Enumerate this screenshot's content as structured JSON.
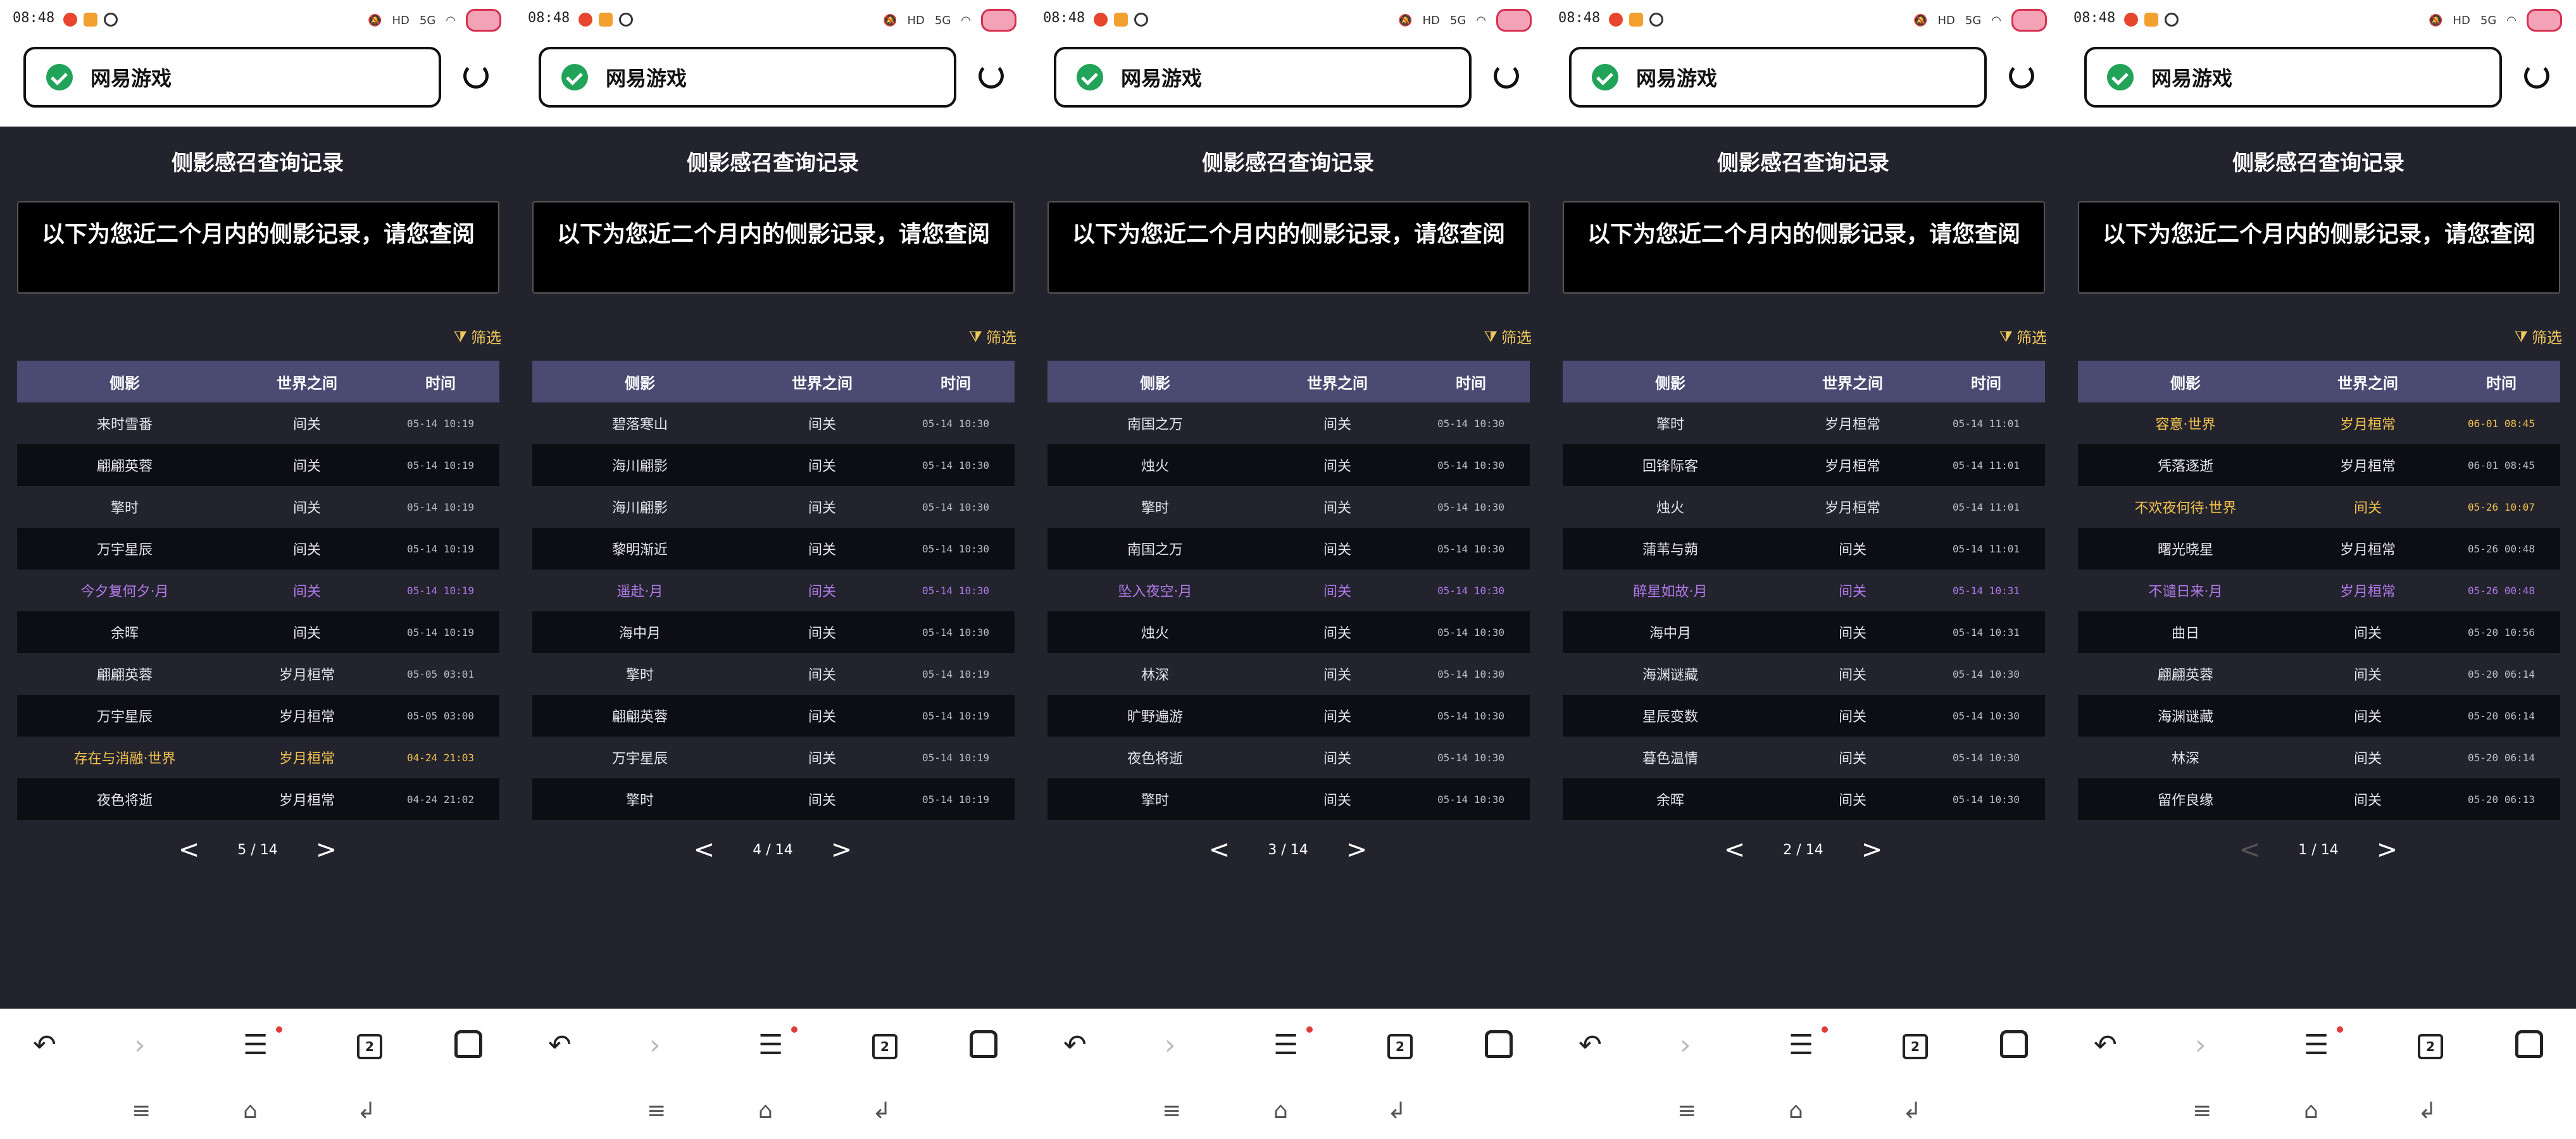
{
  "status": {
    "time": "08:48",
    "network": "5G",
    "hd": "HD"
  },
  "colors": {
    "page_bg": "#23232e",
    "header_row": "#4a4a72",
    "purple": "#b07ae8",
    "gold": "#f2c24e",
    "shield": "#22a35a"
  },
  "browser": {
    "address": "网易游戏",
    "tab_count": "2"
  },
  "page": {
    "title": "侧影感召查询记录",
    "notice": "以下为您近二个月内的侧影记录，请您查阅",
    "filter": "筛选"
  },
  "table_headers": {
    "col1": "侧影",
    "col2": "世界之间",
    "col3": "时间"
  },
  "pager": {
    "prev": "<",
    "next": ">"
  },
  "panels": [
    {
      "page": "5 / 14",
      "rows": [
        {
          "c1": "来时雪番",
          "c2": "间关",
          "c3": "05-14 10:19",
          "style": ""
        },
        {
          "c1": "翩翩英蓉",
          "c2": "间关",
          "c3": "05-14 10:19",
          "style": ""
        },
        {
          "c1": "擎时",
          "c2": "间关",
          "c3": "05-14 10:19",
          "style": ""
        },
        {
          "c1": "万宇星辰",
          "c2": "间关",
          "c3": "05-14 10:19",
          "style": ""
        },
        {
          "c1": "今夕复何夕·月",
          "c2": "间关",
          "c3": "05-14 10:19",
          "style": "purple"
        },
        {
          "c1": "余晖",
          "c2": "间关",
          "c3": "05-14 10:19",
          "style": ""
        },
        {
          "c1": "翩翩英蓉",
          "c2": "岁月桓常",
          "c3": "05-05 03:01",
          "style": ""
        },
        {
          "c1": "万宇星辰",
          "c2": "岁月桓常",
          "c3": "05-05 03:00",
          "style": ""
        },
        {
          "c1": "存在与消融·世界",
          "c2": "岁月桓常",
          "c3": "04-24 21:03",
          "style": "gold"
        },
        {
          "c1": "夜色将逝",
          "c2": "岁月桓常",
          "c3": "04-24 21:02",
          "style": ""
        }
      ]
    },
    {
      "page": "4 / 14",
      "rows": [
        {
          "c1": "碧落寒山",
          "c2": "间关",
          "c3": "05-14 10:30",
          "style": ""
        },
        {
          "c1": "海川翩影",
          "c2": "间关",
          "c3": "05-14 10:30",
          "style": ""
        },
        {
          "c1": "海川翩影",
          "c2": "间关",
          "c3": "05-14 10:30",
          "style": ""
        },
        {
          "c1": "黎明渐近",
          "c2": "间关",
          "c3": "05-14 10:30",
          "style": ""
        },
        {
          "c1": "遥赴·月",
          "c2": "间关",
          "c3": "05-14 10:30",
          "style": "purple"
        },
        {
          "c1": "海中月",
          "c2": "间关",
          "c3": "05-14 10:30",
          "style": ""
        },
        {
          "c1": "擎时",
          "c2": "间关",
          "c3": "05-14 10:19",
          "style": ""
        },
        {
          "c1": "翩翩英蓉",
          "c2": "间关",
          "c3": "05-14 10:19",
          "style": ""
        },
        {
          "c1": "万宇星辰",
          "c2": "间关",
          "c3": "05-14 10:19",
          "style": ""
        },
        {
          "c1": "擎时",
          "c2": "间关",
          "c3": "05-14 10:19",
          "style": ""
        }
      ]
    },
    {
      "page": "3 / 14",
      "rows": [
        {
          "c1": "南国之万",
          "c2": "间关",
          "c3": "05-14 10:30",
          "style": ""
        },
        {
          "c1": "烛火",
          "c2": "间关",
          "c3": "05-14 10:30",
          "style": ""
        },
        {
          "c1": "擎时",
          "c2": "间关",
          "c3": "05-14 10:30",
          "style": ""
        },
        {
          "c1": "南国之万",
          "c2": "间关",
          "c3": "05-14 10:30",
          "style": ""
        },
        {
          "c1": "坠入夜空·月",
          "c2": "间关",
          "c3": "05-14 10:30",
          "style": "purple"
        },
        {
          "c1": "烛火",
          "c2": "间关",
          "c3": "05-14 10:30",
          "style": ""
        },
        {
          "c1": "林深",
          "c2": "间关",
          "c3": "05-14 10:30",
          "style": ""
        },
        {
          "c1": "旷野遍游",
          "c2": "间关",
          "c3": "05-14 10:30",
          "style": ""
        },
        {
          "c1": "夜色将逝",
          "c2": "间关",
          "c3": "05-14 10:30",
          "style": ""
        },
        {
          "c1": "擎时",
          "c2": "间关",
          "c3": "05-14 10:30",
          "style": ""
        }
      ]
    },
    {
      "page": "2 / 14",
      "rows": [
        {
          "c1": "擎时",
          "c2": "岁月桓常",
          "c3": "05-14 11:01",
          "style": ""
        },
        {
          "c1": "回锋际客",
          "c2": "岁月桓常",
          "c3": "05-14 11:01",
          "style": ""
        },
        {
          "c1": "烛火",
          "c2": "岁月桓常",
          "c3": "05-14 11:01",
          "style": ""
        },
        {
          "c1": "蒲苇与蒴",
          "c2": "间关",
          "c3": "05-14 11:01",
          "style": ""
        },
        {
          "c1": "醉星如故·月",
          "c2": "间关",
          "c3": "05-14 10:31",
          "style": "purple"
        },
        {
          "c1": "海中月",
          "c2": "间关",
          "c3": "05-14 10:31",
          "style": ""
        },
        {
          "c1": "海渊谜藏",
          "c2": "间关",
          "c3": "05-14 10:30",
          "style": ""
        },
        {
          "c1": "星辰变数",
          "c2": "间关",
          "c3": "05-14 10:30",
          "style": ""
        },
        {
          "c1": "暮色温情",
          "c2": "间关",
          "c3": "05-14 10:30",
          "style": ""
        },
        {
          "c1": "余晖",
          "c2": "间关",
          "c3": "05-14 10:30",
          "style": ""
        }
      ]
    },
    {
      "page": "1 / 14",
      "rows": [
        {
          "c1": "容意·世界",
          "c2": "岁月桓常",
          "c3": "06-01 08:45",
          "style": "gold"
        },
        {
          "c1": "凭落逐逝",
          "c2": "岁月桓常",
          "c3": "06-01 08:45",
          "style": ""
        },
        {
          "c1": "不欢夜何待·世界",
          "c2": "间关",
          "c3": "05-26 10:07",
          "style": "gold"
        },
        {
          "c1": "曙光晓星",
          "c2": "岁月桓常",
          "c3": "05-26 00:48",
          "style": ""
        },
        {
          "c1": "不谴日来·月",
          "c2": "岁月桓常",
          "c3": "05-26 00:48",
          "style": "purple"
        },
        {
          "c1": "曲日",
          "c2": "间关",
          "c3": "05-20 10:56",
          "style": ""
        },
        {
          "c1": "翩翩英蓉",
          "c2": "间关",
          "c3": "05-20 06:14",
          "style": ""
        },
        {
          "c1": "海渊谜藏",
          "c2": "间关",
          "c3": "05-20 06:14",
          "style": ""
        },
        {
          "c1": "林深",
          "c2": "间关",
          "c3": "05-20 06:14",
          "style": ""
        },
        {
          "c1": "留作良缘",
          "c2": "间关",
          "c3": "05-20 06:13",
          "style": ""
        }
      ]
    }
  ]
}
